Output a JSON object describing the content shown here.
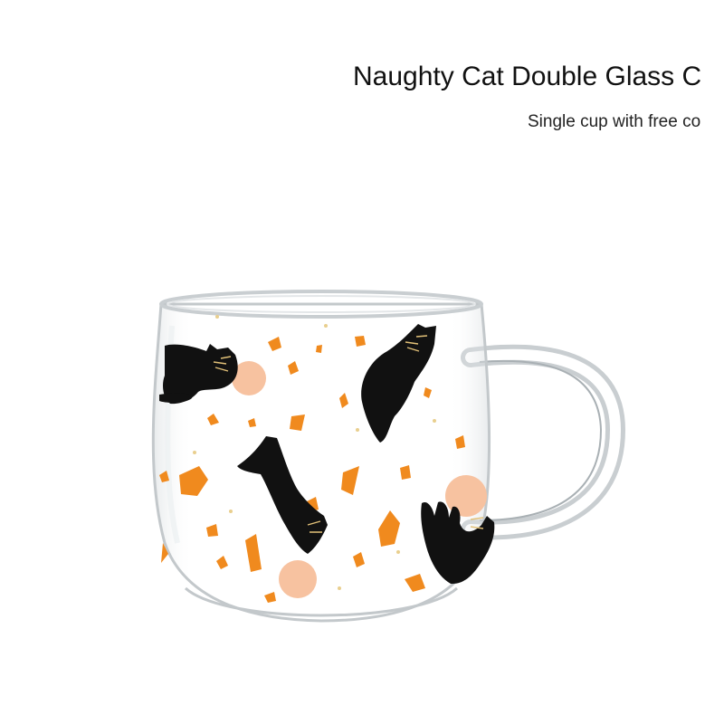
{
  "product": {
    "title": "Naughty Cat Double Glass C",
    "subtitle": "Single cup with free co"
  },
  "colors": {
    "background": "#ffffff",
    "cat": "#111111",
    "confetti_orange": "#f08a1e",
    "ball_peach": "#f7c2a0",
    "glass_edge": "#c8cdd0"
  },
  "image": {
    "subject": "mug-photo"
  }
}
